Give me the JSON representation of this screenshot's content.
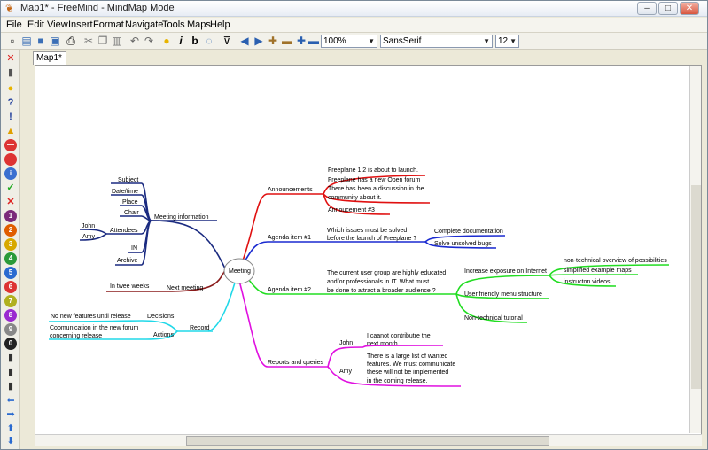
{
  "window": {
    "title": "Map1* - FreeMind - MindMap Mode",
    "min": "–",
    "max": "□",
    "close": "✕"
  },
  "menu": [
    "File",
    "Edit",
    "View",
    "Insert",
    "Format",
    "Navigate",
    "Tools",
    "Maps",
    "Help"
  ],
  "toolbar": {
    "zoom": "100%",
    "font": "SansSerif",
    "size": "12"
  },
  "tab": "Map1*",
  "map": {
    "center": "Meeting",
    "info": {
      "label": "Meeting information",
      "items": [
        "Subject",
        "Date/time",
        "Place",
        "Chair",
        "Attendees",
        "IN",
        "Archive"
      ],
      "attendees": [
        "John",
        "Amy"
      ]
    },
    "next": {
      "label": "Next meeting",
      "child": "In twee weeks"
    },
    "record": {
      "label": "Record",
      "decisions": "Decisions",
      "decisions_child": "No new features until release",
      "actions": "Actions",
      "actions_child": [
        "Coomunication in the new forum",
        "concerning release"
      ]
    },
    "announce": {
      "label": "Announcements",
      "items": [
        "Freeplane 1.2 is about to launch.",
        "Freeplane has a new Open forum",
        "There has been a discussion in the",
        "community about it.",
        "Annoucement #3"
      ]
    },
    "agenda1": {
      "label": "Agenda item #1",
      "text": [
        "Which issues must be solved",
        "before the launch of Freeplane ?"
      ],
      "children": [
        "Complete documentation",
        "Solve unsolved bugs"
      ]
    },
    "agenda2": {
      "label": "Agenda item #2",
      "text": [
        "The current user group are highly educated",
        "and/or professionals in IT. What must",
        "be done to attract a broader audience ?"
      ],
      "c1": "Increase exposure on Internet",
      "c1kids": [
        "non-technical overview of possibilities",
        "simplified example maps",
        "instructon videos"
      ],
      "c2": "User friendly menu structure",
      "c3": "Non-technical tutorial"
    },
    "reports": {
      "label": "Reports and queries",
      "john": "John",
      "john_text": [
        "I caanot contributre the",
        "next month"
      ],
      "amy": "Amy",
      "amy_text": [
        "There is a large list of wanted",
        "features. We must communicate",
        "these will not be implemented",
        "in the coming release."
      ]
    }
  }
}
